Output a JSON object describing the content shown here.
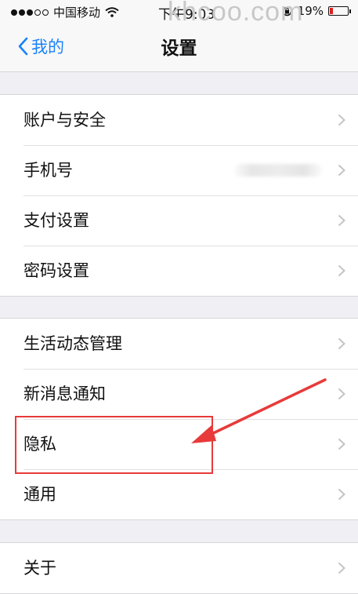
{
  "status": {
    "carrier": "中国移动",
    "time": "下午9:03",
    "battery_text": "19%",
    "battery_level": 0.19,
    "watermark": "khcoo.com"
  },
  "nav": {
    "back_label": "我的",
    "title": "设置"
  },
  "groups": [
    {
      "items": [
        {
          "label": "账户与安全"
        },
        {
          "label": "手机号",
          "value": ""
        },
        {
          "label": "支付设置"
        },
        {
          "label": "密码设置"
        }
      ]
    },
    {
      "items": [
        {
          "label": "生活动态管理"
        },
        {
          "label": "新消息通知"
        },
        {
          "label": "隐私"
        },
        {
          "label": "通用"
        }
      ]
    },
    {
      "items": [
        {
          "label": "关于"
        }
      ]
    }
  ],
  "colors": {
    "accent": "#1a82fb",
    "annotation": "#e83a3a",
    "battery_low": "#e02020"
  }
}
